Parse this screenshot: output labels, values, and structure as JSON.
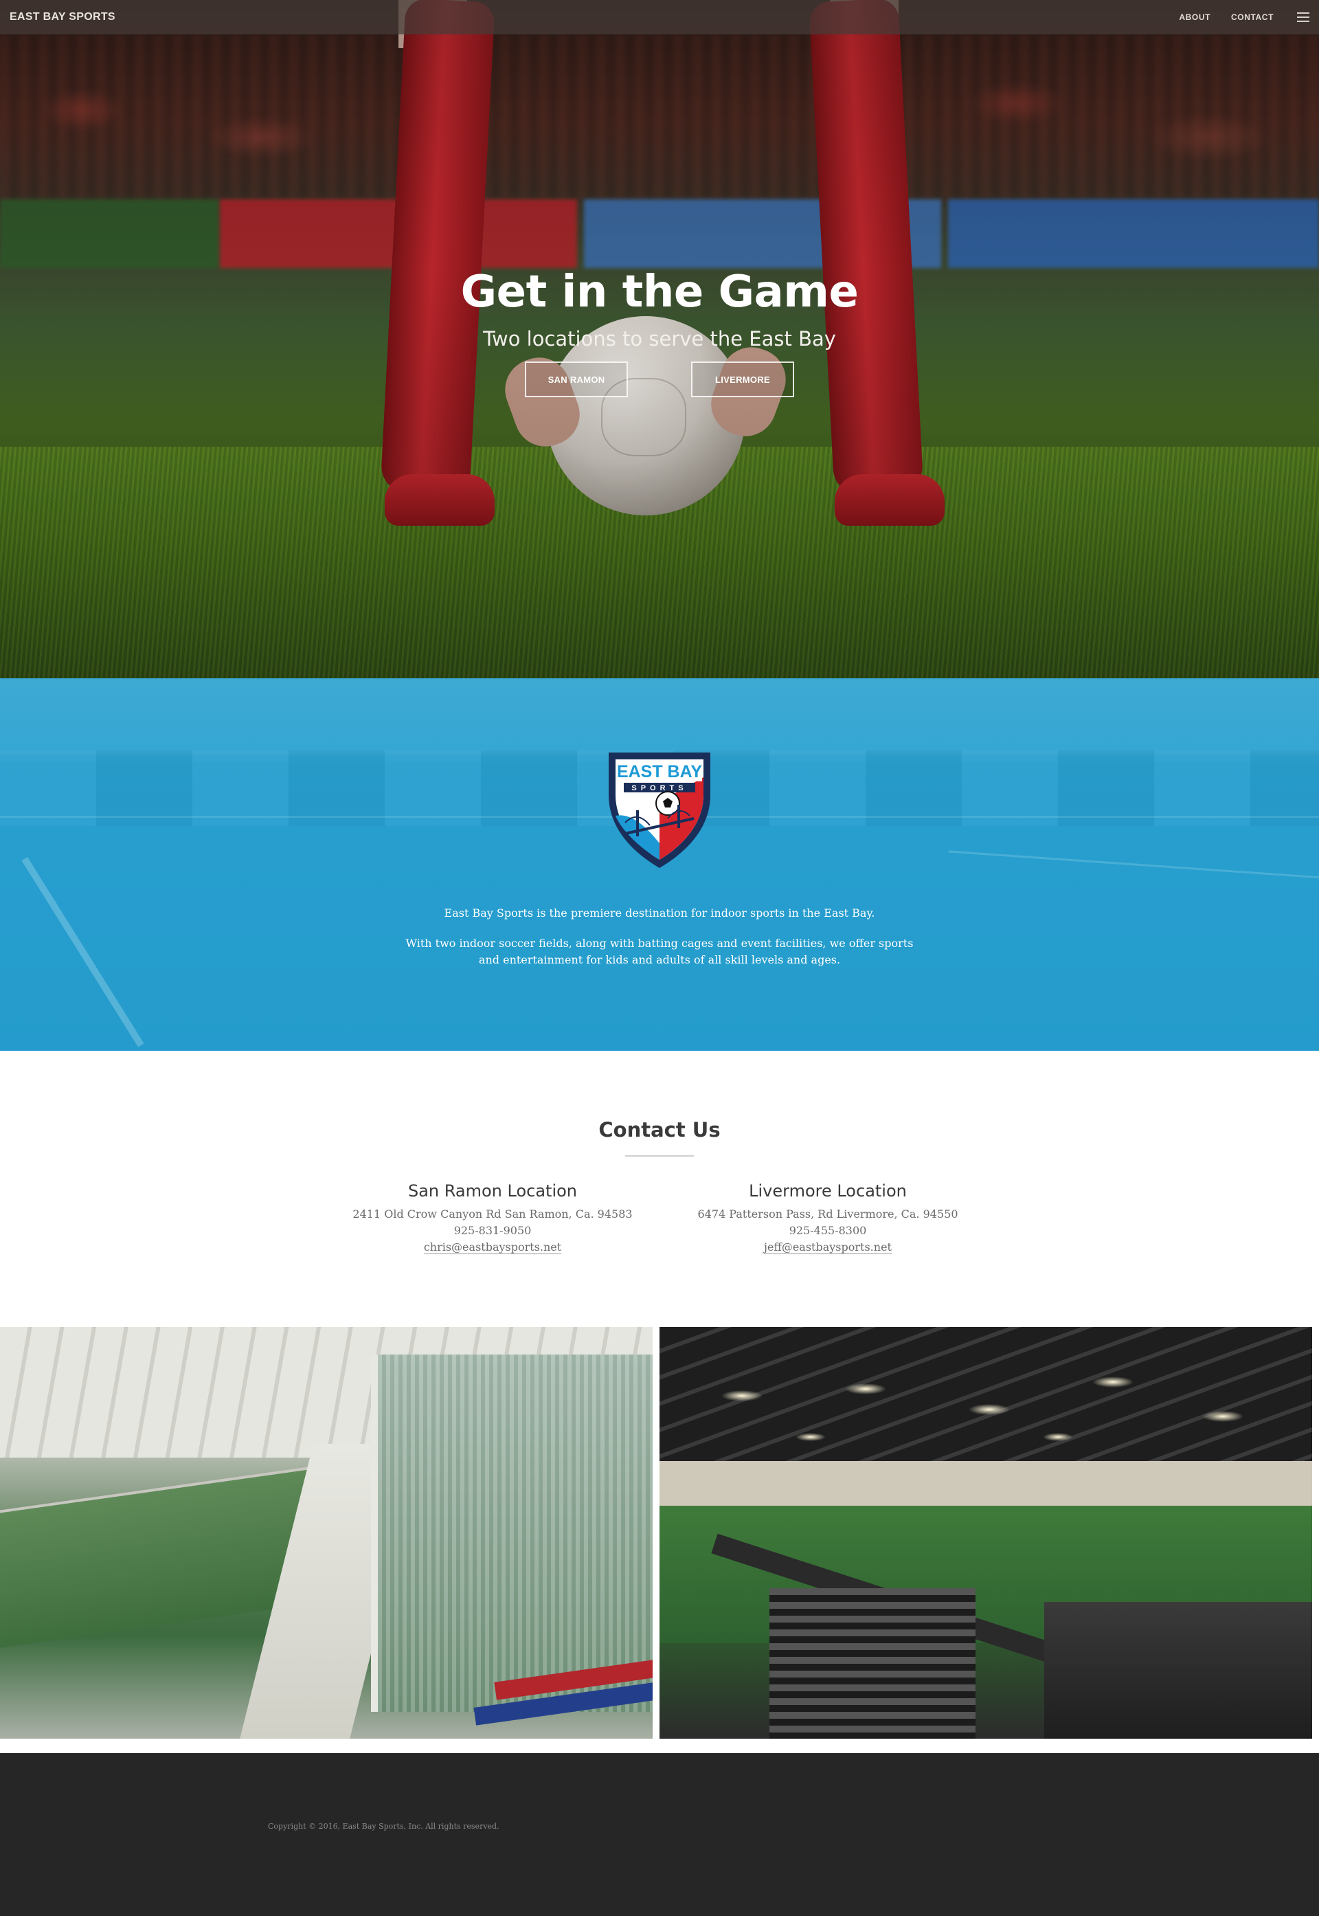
{
  "nav": {
    "brand": "EAST BAY SPORTS",
    "links": [
      "ABOUT",
      "CONTACT"
    ],
    "menu_icon": "hamburger-menu-icon"
  },
  "hero": {
    "title": "Get in the Game",
    "subtitle": "Two locations to serve the East Bay",
    "buttons": [
      "SAN RAMON",
      "LIVERMORE"
    ]
  },
  "about": {
    "logo_text_top": "EAST BAY",
    "logo_text_sub": "SPORTS",
    "paragraph1": "East Bay Sports is the premiere destination for indoor sports in the East Bay.",
    "paragraph2": "With two indoor soccer fields, along with batting cages and event facilities, we offer sports and entertainment for kids and adults of all skill levels and ages."
  },
  "contact": {
    "title": "Contact Us",
    "locations": [
      {
        "name": "San Ramon Location",
        "address": "2411 Old Crow Canyon Rd San Ramon, Ca. 94583",
        "phone": "925-831-9050",
        "email": "chris@eastbaysports.net"
      },
      {
        "name": "Livermore Location",
        "address": "6474 Patterson Pass, Rd Livermore, Ca. 94550",
        "phone": "925-455-8300",
        "email": "jeff@eastbaysports.net"
      }
    ]
  },
  "footer": {
    "copyright": "Copyright © 2016, East Bay Sports, Inc. All rights reserved."
  },
  "colors": {
    "nav_bg": "#463c38",
    "about_bg": "#2fa0cf",
    "footer_bg": "#262626",
    "logo_red": "#d8232a",
    "logo_blue": "#1d9ad6",
    "logo_navy": "#1a2e5a"
  }
}
